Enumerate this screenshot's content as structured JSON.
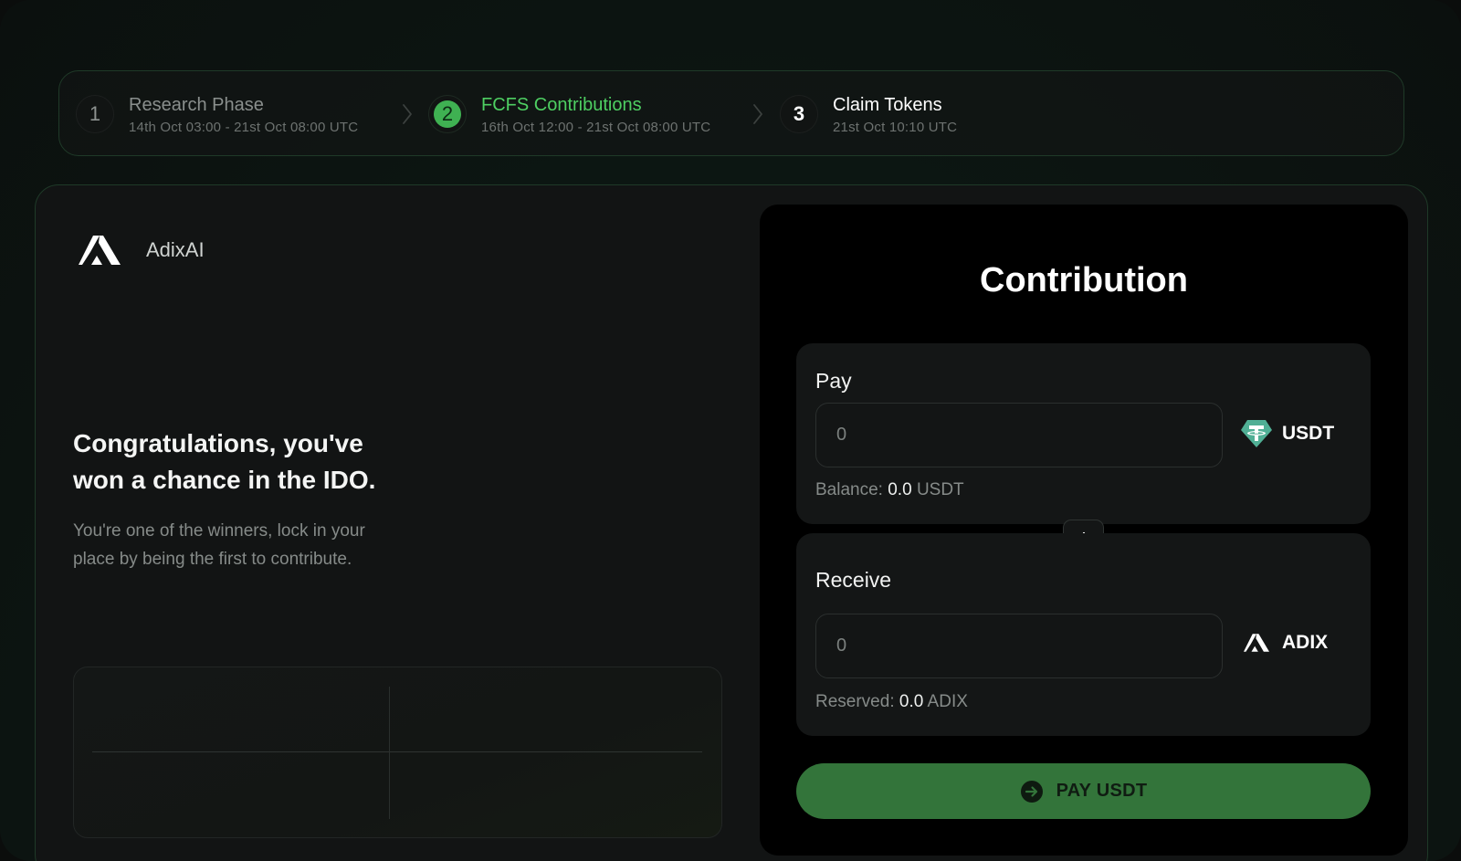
{
  "brand": {
    "name": "AdixAI",
    "logo_icon": "adix-logo-icon"
  },
  "stepper": {
    "steps": [
      {
        "number": "1",
        "title": "Research Phase",
        "date": "14th Oct 03:00 - 21st Oct 08:00 UTC",
        "state": "done"
      },
      {
        "number": "2",
        "title": "FCFS Contributions",
        "date": "16th Oct 12:00 - 21st Oct 08:00 UTC",
        "state": "active"
      },
      {
        "number": "3",
        "title": "Claim Tokens",
        "date": "21st Oct 10:10 UTC",
        "state": "upcoming"
      }
    ],
    "separator_icon": "chevron-right-icon"
  },
  "hero": {
    "heading_line1": "Congratulations, you've",
    "heading_line2": "won a chance in the IDO.",
    "subtext_line1": "You're one of the winners, lock in your",
    "subtext_line2": "place by being the first to contribute."
  },
  "contribution": {
    "title": "Contribution",
    "pay": {
      "label": "Pay",
      "value": "",
      "placeholder": "0",
      "token": "USDT",
      "token_icon": "tether-icon",
      "balance_label": "Balance:",
      "balance_value": "0.0",
      "balance_unit": "USDT"
    },
    "swap_icon": "arrow-down-icon",
    "receive": {
      "label": "Receive",
      "value": "",
      "placeholder": "0",
      "token": "ADIX",
      "token_icon": "adix-logo-icon",
      "reserved_label": "Reserved:",
      "reserved_value": "0.0",
      "reserved_unit": "ADIX"
    },
    "button": {
      "label": "PAY USDT",
      "icon": "arrow-right-circle-icon"
    }
  },
  "colors": {
    "accent_green": "#4ecf62",
    "button_green": "#33743a",
    "tether_green": "#50af95"
  }
}
